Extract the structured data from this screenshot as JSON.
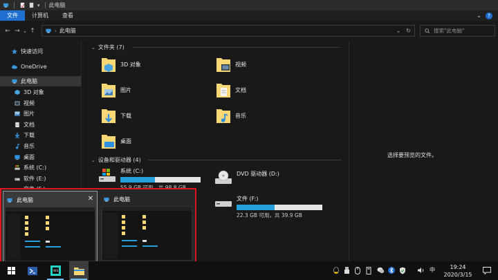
{
  "window": {
    "title": "此电脑"
  },
  "ribbon": {
    "tabs": [
      "文件",
      "计算机",
      "查看"
    ]
  },
  "address": {
    "path": "此电脑"
  },
  "search": {
    "placeholder": "搜索\"此电脑\""
  },
  "nav": {
    "items": [
      {
        "label": "快速访问",
        "icon": "star-icon"
      },
      {
        "label": "OneDrive",
        "icon": "cloud-icon"
      },
      {
        "label": "此电脑",
        "icon": "computer-icon"
      },
      {
        "label": "3D 对象",
        "icon": "3d-objects-icon"
      },
      {
        "label": "视频",
        "icon": "video-icon"
      },
      {
        "label": "图片",
        "icon": "picture-icon"
      },
      {
        "label": "文档",
        "icon": "document-icon"
      },
      {
        "label": "下载",
        "icon": "download-icon"
      },
      {
        "label": "音乐",
        "icon": "music-icon"
      },
      {
        "label": "桌面",
        "icon": "desktop-icon"
      },
      {
        "label": "系统 (C:)",
        "icon": "system-drive-icon"
      },
      {
        "label": "软件 (E:)",
        "icon": "drive-icon"
      },
      {
        "label": "文件 (F:)",
        "icon": "drive-icon"
      }
    ]
  },
  "folders": {
    "header": "文件夹 (7)",
    "items": [
      "3D 对象",
      "视频",
      "图片",
      "文档",
      "下载",
      "音乐",
      "桌面"
    ]
  },
  "devices": {
    "header": "设备和驱动器 (4)",
    "items": [
      {
        "name": "系统 (C:)",
        "size": "55.9 GB 可用，共 98.8 GB",
        "used": 0.43
      },
      {
        "name": "DVD 驱动器 (D:)",
        "size": "",
        "used": 0
      },
      {
        "name": "软件 (E:)",
        "size": "",
        "used": 0.55
      },
      {
        "name": "文件 (F:)",
        "size": "22.3 GB 可用，共 39.9 GB",
        "used": 0.44
      }
    ]
  },
  "preview": {
    "text": "选择要预览的文件。"
  },
  "thumbnails": [
    {
      "title": "此电脑"
    },
    {
      "title": "此电脑"
    }
  ],
  "taskbar": {
    "clock_time": "19:24",
    "clock_date": "2020/3/15"
  },
  "colors": {
    "accent": "#1f6fd1",
    "drive_fill": "#26a0da",
    "highlight": "#e0151f"
  }
}
